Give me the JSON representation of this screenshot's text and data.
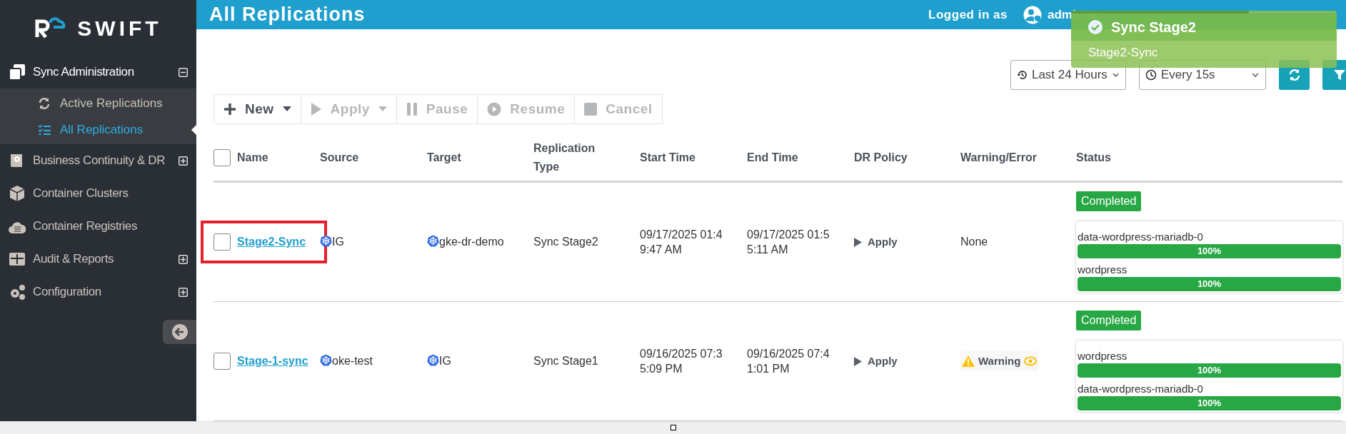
{
  "logo": {
    "text": "SWIFT"
  },
  "sidebar": {
    "items": [
      {
        "kind": "group",
        "label": "Sync Administration",
        "expanded": true,
        "children": [
          {
            "label": "Active Replications",
            "selected": false
          },
          {
            "label": "All Replications",
            "selected": true
          }
        ]
      },
      {
        "kind": "group",
        "label": "Business Continuity & DR",
        "expanded": false
      },
      {
        "kind": "link",
        "label": "Container Clusters"
      },
      {
        "kind": "link",
        "label": "Container Registries"
      },
      {
        "kind": "group",
        "label": "Audit & Reports",
        "expanded": false
      },
      {
        "kind": "group",
        "label": "Configuration",
        "expanded": false
      }
    ]
  },
  "header": {
    "title": "All Replications",
    "logged_in_label": "Logged in as",
    "user": "admin"
  },
  "toast": {
    "title": "Sync Stage2",
    "message": "Stage2-Sync",
    "level": 0.67
  },
  "filters": {
    "time_range": "Last 24 Hours",
    "refresh_interval": "Every 15s"
  },
  "toolbar": [
    {
      "kind": "new",
      "label": "New",
      "disabled": false,
      "dropdown": true
    },
    {
      "kind": "apply",
      "label": "Apply",
      "disabled": true,
      "dropdown": true
    },
    {
      "kind": "pause",
      "label": "Pause",
      "disabled": true,
      "dropdown": false
    },
    {
      "kind": "resume",
      "label": "Resume",
      "disabled": true,
      "dropdown": false
    },
    {
      "kind": "cancel",
      "label": "Cancel",
      "disabled": true,
      "dropdown": false
    }
  ],
  "table": {
    "select_all_checked": false,
    "columns": [
      "Name",
      "Source",
      "Target",
      "Replication Type",
      "Start Time",
      "End Time",
      "DR Policy",
      "Warning/Error",
      "Status"
    ],
    "rows": [
      {
        "checked": false,
        "highlighted": true,
        "name": "Stage2-Sync",
        "source": "IG",
        "target": "gke-dr-demo",
        "type": "Sync Stage2",
        "start": "09/17/2025 01:49:47 AM",
        "end": "09/17/2025 01:55:11 AM",
        "dr_policy": "Apply",
        "warning": {
          "kind": "none",
          "text": "None"
        },
        "status": "Completed",
        "volumes": [
          {
            "name": "data-wordpress-mariadb-0",
            "level": 1,
            "reading": "100%"
          },
          {
            "name": "wordpress",
            "level": 1,
            "reading": "100%"
          }
        ]
      },
      {
        "checked": false,
        "highlighted": false,
        "name": "Stage-1-sync",
        "source": "oke-test",
        "target": "IG",
        "type": "Sync Stage1",
        "start": "09/16/2025 07:35:09 PM",
        "end": "09/16/2025 07:41:01 PM",
        "dr_policy": "Apply",
        "warning": {
          "kind": "warning",
          "text": "Warning"
        },
        "status": "Completed",
        "volumes": [
          {
            "name": "wordpress",
            "level": 1,
            "reading": "100%"
          },
          {
            "name": "data-wordpress-mariadb-0",
            "level": 1,
            "reading": "100%"
          }
        ]
      }
    ]
  }
}
